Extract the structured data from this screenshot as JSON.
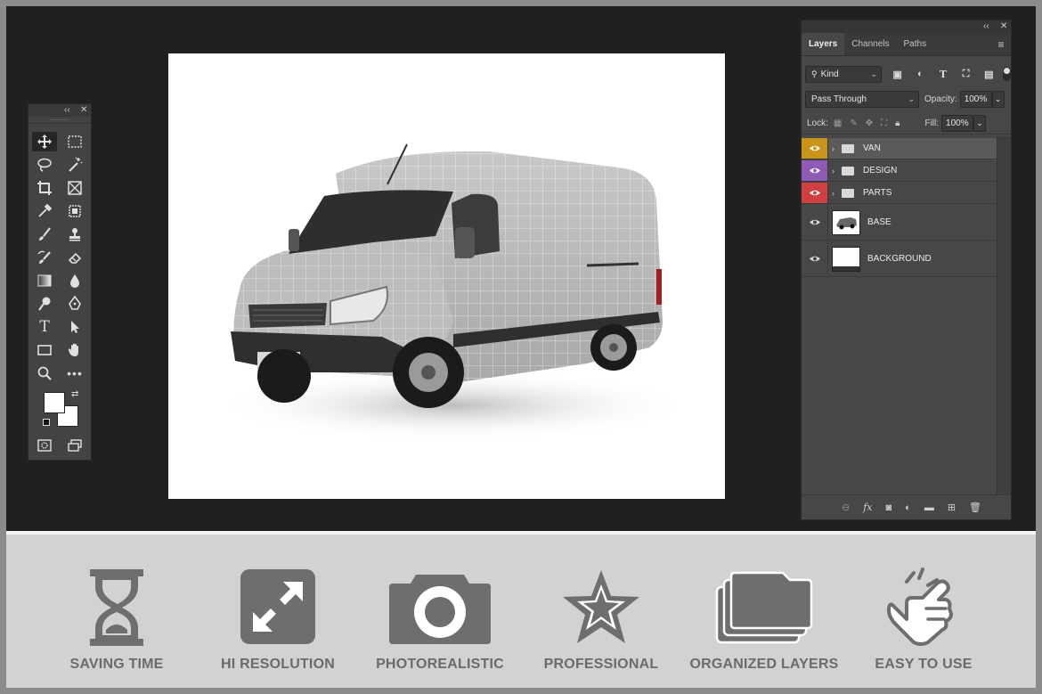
{
  "toolbox": {
    "collapse": "‹‹",
    "close": "✕"
  },
  "layers_panel": {
    "collapse": "‹‹",
    "close": "✕",
    "tabs": [
      "Layers",
      "Channels",
      "Paths"
    ],
    "filter": {
      "value": "Kind"
    },
    "blend_mode": "Pass Through",
    "opacity_label": "Opacity:",
    "opacity_value": "100%",
    "lock_label": "Lock:",
    "fill_label": "Fill:",
    "fill_value": "100%",
    "layers": [
      {
        "name": "VAN",
        "type": "group",
        "color": "#c8941a"
      },
      {
        "name": "DESIGN",
        "type": "group",
        "color": "#8e5ab5"
      },
      {
        "name": "PARTS",
        "type": "group",
        "color": "#d04040"
      },
      {
        "name": "BASE",
        "type": "layer"
      },
      {
        "name": "BACKGROUND",
        "type": "layer"
      }
    ]
  },
  "features": [
    {
      "label": "SAVING TIME",
      "icon": "hourglass-icon"
    },
    {
      "label": "HI RESOLUTION",
      "icon": "expand-arrows-icon"
    },
    {
      "label": "PHOTOREALISTIC",
      "icon": "camera-icon"
    },
    {
      "label": "PROFESSIONAL",
      "icon": "star-icon"
    },
    {
      "label": "ORGANIZED LAYERS",
      "icon": "stacked-folders-icon"
    },
    {
      "label": "EASY TO USE",
      "icon": "tap-hand-icon"
    }
  ],
  "colors": {
    "workspace": "#202020",
    "panel": "#474747",
    "icon_gray": "#6e6e6e"
  }
}
